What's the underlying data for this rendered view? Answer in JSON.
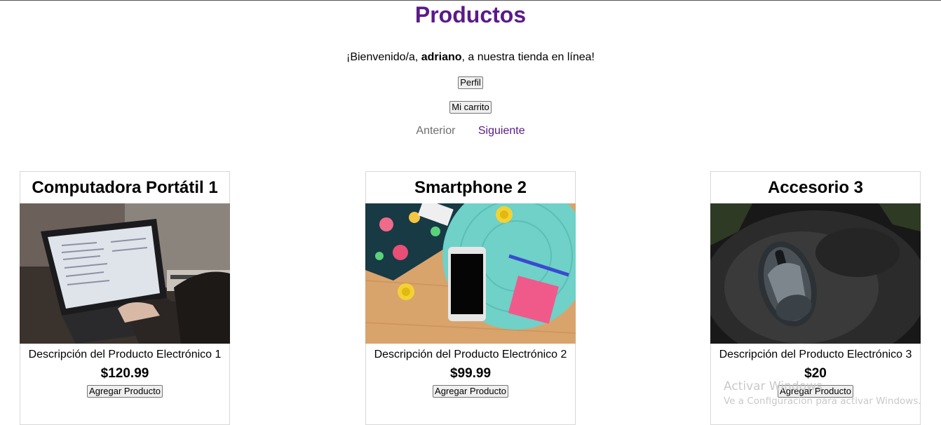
{
  "header": {
    "title": "Productos"
  },
  "welcome": {
    "prefix": "¡Bienvenido/a, ",
    "username": "adriano",
    "suffix": ", a nuestra tienda en línea!"
  },
  "buttons": {
    "profile": "Perfil",
    "cart": "Mi carrito"
  },
  "pagination": {
    "previous": "Anterior",
    "next": "Siguiente"
  },
  "products": [
    {
      "name": "Computadora Portátil 1",
      "description": "Descripción del Producto Electrónico 1",
      "price": "$120.99",
      "button": "Agregar Producto",
      "image": "laptop-photo"
    },
    {
      "name": "Smartphone 2",
      "description": "Descripción del Producto Electrónico 2",
      "price": "$99.99",
      "button": "Agregar Producto",
      "image": "smartphone-photo"
    },
    {
      "name": "Accesorio 3",
      "description": "Descripción del Producto Electrónico 3",
      "price": "$20",
      "button": "Agregar Producto",
      "image": "mouse-photo"
    }
  ],
  "watermark": {
    "line1": "Activar Windows",
    "line2": "Ve a Configuración para activar Windows."
  },
  "colors": {
    "title": "#5a1a8a",
    "next_link": "#5a1a8a",
    "prev_link": "#6d6d6d"
  }
}
